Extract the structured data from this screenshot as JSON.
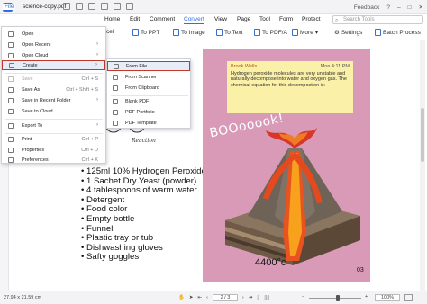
{
  "titlebar": {
    "app_label": "File",
    "file_name": "science-copy.pdf",
    "feedback": "Feedback",
    "help_icon": "help-icon",
    "minimize_icon": "minimize-icon",
    "maximize_icon": "maximize-icon",
    "close_icon": "close-icon"
  },
  "menubar": {
    "items": [
      "Home",
      "Edit",
      "Comment",
      "Convert",
      "View",
      "Page",
      "Tool",
      "Form",
      "Protect"
    ],
    "active": "Convert",
    "search_placeholder": "Search Tools"
  },
  "toolbar": {
    "items": [
      "To PPT",
      "To Image",
      "To Text",
      "To PDF/A",
      "More",
      "Settings",
      "Batch Process"
    ],
    "partial_left": "cel"
  },
  "file_menu": {
    "items": [
      {
        "label": "Open",
        "shortcut": "",
        "icon": "open-icon",
        "enabled": true
      },
      {
        "label": "Open Recent",
        "shortcut": "",
        "icon": "recent-icon",
        "enabled": true,
        "arrow": true
      },
      {
        "label": "Open Cloud",
        "shortcut": "",
        "icon": "cloud-icon",
        "enabled": true,
        "arrow": true
      },
      {
        "label": "Create",
        "shortcut": "",
        "icon": "create-icon",
        "enabled": true,
        "arrow": true,
        "highlighted": true
      },
      {
        "label": "Save",
        "shortcut": "Ctrl + S",
        "icon": "save-icon",
        "enabled": false
      },
      {
        "label": "Save As",
        "shortcut": "Ctrl + Shift + S",
        "icon": "save-as-icon",
        "enabled": true
      },
      {
        "label": "Save in Recent Folder",
        "shortcut": "",
        "icon": "folder-icon",
        "enabled": true,
        "arrow": true
      },
      {
        "label": "Save to Cloud",
        "shortcut": "",
        "icon": "cloud-upload-icon",
        "enabled": true
      },
      {
        "label": "Export To",
        "shortcut": "",
        "icon": "export-icon",
        "enabled": true,
        "arrow": true
      },
      {
        "label": "Print",
        "shortcut": "Ctrl + P",
        "icon": "print-icon",
        "enabled": true
      },
      {
        "label": "Properties",
        "shortcut": "Ctrl + D",
        "icon": "properties-icon",
        "enabled": true
      },
      {
        "label": "Preferences",
        "shortcut": "Ctrl + K",
        "icon": "preferences-icon",
        "enabled": true
      }
    ]
  },
  "create_submenu": {
    "items": [
      {
        "label": "From File",
        "icon": "file-icon",
        "highlighted": true
      },
      {
        "label": "From Scanner",
        "icon": "scanner-icon"
      },
      {
        "label": "From Clipboard",
        "icon": "clipboard-icon"
      },
      {
        "label": "Blank PDF",
        "icon": "blank-pdf-icon"
      },
      {
        "label": "PDF Portfolio",
        "icon": "portfolio-icon"
      },
      {
        "label": "PDF Template",
        "icon": "template-icon"
      }
    ]
  },
  "document": {
    "reaction_label": "Reaction",
    "ingredients": [
      "125ml 10% Hydrogen Peroxide",
      "1 Sachet Dry Yeast (powder)",
      "4 tablespoons of warm water",
      "Detergent",
      "Food color",
      "Empty bottle",
      "Funnel",
      "Plastic tray or tub",
      "Dishwashing gloves",
      "Safty goggles"
    ],
    "note": {
      "author": "Brook Wells",
      "time": "Mon 4:11 PM",
      "text": "Hydrogen peroxide molecules are very unstable and naturally decompose into water and oxygen gas. The chemical equation for this decompostion is:"
    },
    "boom_text": "BOOooook!",
    "temperature": "4400°c",
    "page_number": "03",
    "page_bg_color": "#d89ab6"
  },
  "statusbar": {
    "page_size": "27.94 x 21.59 cm",
    "page_indicator": "2 / 3",
    "zoom": "100%",
    "zoom_level": 0.55
  }
}
